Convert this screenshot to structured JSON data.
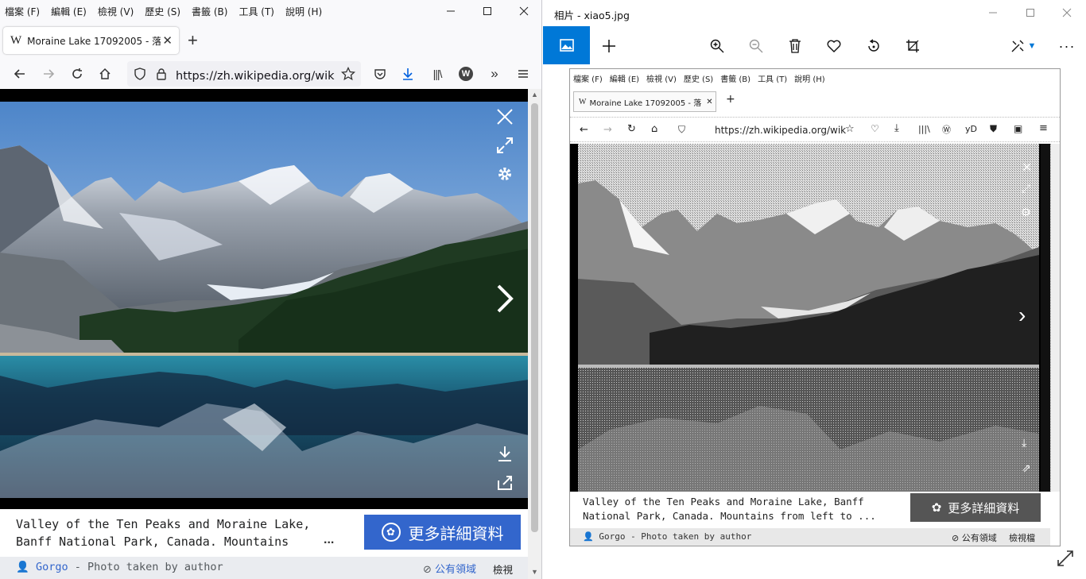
{
  "left_window": {
    "menu": [
      "檔案 (F)",
      "編輯 (E)",
      "檢視 (V)",
      "歷史 (S)",
      "書籤 (B)",
      "工具 (T)",
      "說明 (H)"
    ],
    "tab_title": "Moraine Lake 17092005 - 落",
    "url": "https://zh.wikipedia.org/wiki/落",
    "caption": "Valley of the Ten Peaks and Moraine Lake,\nBanff National Park, Canada. Mountains",
    "ellipsis": "...",
    "more_button": "更多詳細資料",
    "author_name": "Gorgo",
    "author_suffix": " - Photo taken by author",
    "license": "公有領域",
    "view_label": "檢視",
    "colors": {
      "accent": "#3366cc",
      "sky": "#5a93d6",
      "lake": "#1f6f8b",
      "forest": "#1f3a22"
    }
  },
  "right_window": {
    "title": "相片 - xiao5.jpg",
    "inner": {
      "menu": [
        "檔案 (F)",
        "編輯 (E)",
        "檢視 (V)",
        "歷史 (S)",
        "書籤 (B)",
        "工具 (T)",
        "說明 (H)"
      ],
      "tab_title": "Moraine Lake 17092005 - 落",
      "url": "https://zh.wikipedia.org/wik",
      "yd": "yD",
      "caption": "Valley of the Ten Peaks and Moraine Lake, Banff\nNational Park, Canada. Mountains from left to ...",
      "more_button": "更多詳細資料",
      "author_line": "Gorgo - Photo taken by author",
      "license": "公有領域",
      "view_label": "檢視檔"
    }
  }
}
